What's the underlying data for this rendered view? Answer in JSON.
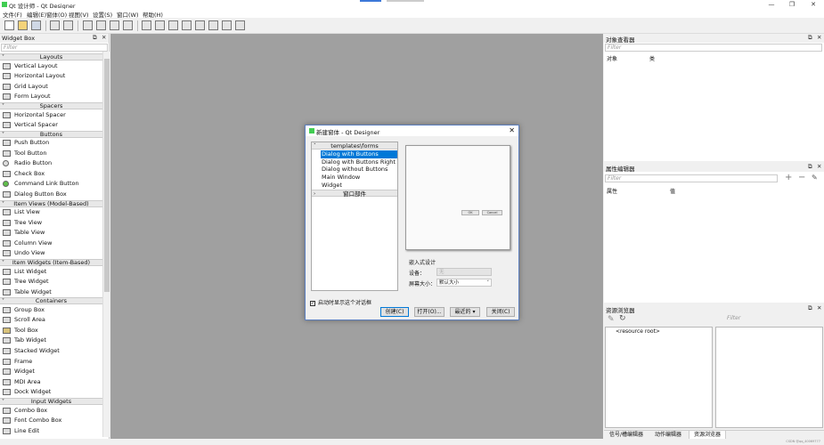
{
  "window": {
    "title": "Qt 设计师 - Qt Designer",
    "controls": {
      "minimize": "—",
      "restore": "❐",
      "close": "✕"
    }
  },
  "menu": [
    "文件(F)",
    "编辑(E)",
    "窗体(O)",
    "视图(V)",
    "设置(S)",
    "窗口(W)",
    "帮助(H)"
  ],
  "widget_box": {
    "title": "Widget Box",
    "filter_placeholder": "Filter",
    "categories": [
      {
        "label": "Layouts",
        "items": [
          "Vertical Layout",
          "Horizontal Layout",
          "Grid Layout",
          "Form Layout"
        ]
      },
      {
        "label": "Spacers",
        "items": [
          "Horizontal Spacer",
          "Vertical Spacer"
        ]
      },
      {
        "label": "Buttons",
        "items": [
          "Push Button",
          "Tool Button",
          "Radio Button",
          "Check Box",
          "Command Link Button",
          "Dialog Button Box"
        ]
      },
      {
        "label": "Item Views (Model-Based)",
        "items": [
          "List View",
          "Tree View",
          "Table View",
          "Column View",
          "Undo View"
        ]
      },
      {
        "label": "Item Widgets (Item-Based)",
        "items": [
          "List Widget",
          "Tree Widget",
          "Table Widget"
        ]
      },
      {
        "label": "Containers",
        "items": [
          "Group Box",
          "Scroll Area",
          "Tool Box",
          "Tab Widget",
          "Stacked Widget",
          "Frame",
          "Widget",
          "MDI Area",
          "Dock Widget"
        ]
      },
      {
        "label": "Input Widgets",
        "items": [
          "Combo Box",
          "Font Combo Box",
          "Line Edit"
        ]
      }
    ]
  },
  "dialog": {
    "title": "新建窗体 - Qt Designer",
    "close": "✕",
    "tree_header": "templates\\forms",
    "templates": [
      "Dialog with Buttons Bottom",
      "Dialog with Buttons Right",
      "Dialog without Buttons",
      "Main Window",
      "Widget"
    ],
    "selected_template": "Dialog with Buttons Bottom",
    "widgets_header": "窗口部件",
    "preview_buttons": [
      "OK",
      "Cancel"
    ],
    "embedded_design": "嵌入式设计",
    "device_label": "设备：",
    "device_value": "无",
    "screen_size_label": "屏幕大小：",
    "screen_size_value": "默认大小",
    "show_on_startup": "启动时显示这个对话框",
    "show_on_startup_checked": true,
    "buttons": {
      "create": "创建(C)",
      "open": "打开(O)...",
      "recent": "最近的",
      "close": "关闭(C)"
    }
  },
  "object_inspector": {
    "title": "对象查看器",
    "filter_placeholder": "Filter",
    "col_object": "对象",
    "col_class": "类"
  },
  "property_editor": {
    "title": "属性编辑器",
    "filter_placeholder": "Filter",
    "col_property": "属性",
    "col_value": "值",
    "add": "+",
    "remove": "−"
  },
  "resource_browser": {
    "title": "资源浏览器",
    "filter_placeholder": "Filter",
    "root": "<resource root>"
  },
  "bottom_tabs": [
    "信号/槽编辑器",
    "动作编辑器",
    "资源浏览器"
  ],
  "active_bottom_tab": "资源浏览器",
  "dock_controls": {
    "float": "⧉",
    "close": "✕"
  },
  "watermark": "CSDN @qq_40069777"
}
